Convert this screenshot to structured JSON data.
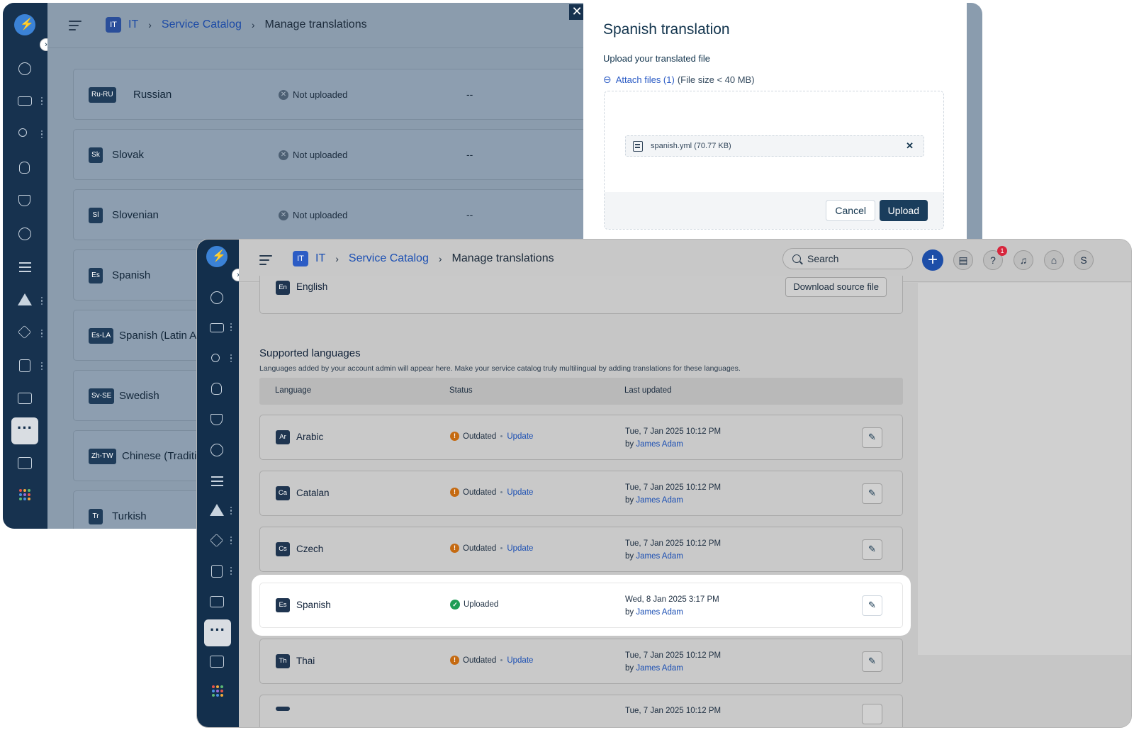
{
  "breadcrumb": {
    "workspace_badge": "IT",
    "workspace": "IT",
    "catalog": "Service Catalog",
    "current": "Manage translations"
  },
  "back": {
    "rows": [
      {
        "code": "Ru-RU",
        "name": "Russian",
        "status": "Not uploaded",
        "updated": "--"
      },
      {
        "code": "Sk",
        "name": "Slovak",
        "status": "Not uploaded",
        "updated": "--"
      },
      {
        "code": "Sl",
        "name": "Slovenian",
        "status": "Not uploaded",
        "updated": "--"
      },
      {
        "code": "Es",
        "name": "Spanish"
      },
      {
        "code": "Es-LA",
        "name": "Spanish (Latin Ar"
      },
      {
        "code": "Sv-SE",
        "name": "Swedish"
      },
      {
        "code": "Zh-TW",
        "name": "Chinese (Traditio"
      },
      {
        "code": "Tr",
        "name": "Turkish"
      }
    ]
  },
  "modal": {
    "title": "Spanish translation",
    "subtitle": "Upload your translated file",
    "attach_label": "Attach files (1)",
    "attach_note": "(File size < 40 MB)",
    "file_name": "spanish.yml (70.77 KB)",
    "cancel": "Cancel",
    "upload": "Upload"
  },
  "header": {
    "search_placeholder": "Search",
    "notification_count": "1",
    "avatar_initial": "S"
  },
  "source": {
    "code": "En",
    "name": "English",
    "download_label": "Download source file"
  },
  "supported": {
    "title": "Supported languages",
    "description": "Languages added by your account admin will appear here. Make your service catalog truly multilingual by adding translations for these languages.",
    "columns": [
      "Language",
      "Status",
      "Last updated"
    ],
    "rows": [
      {
        "code": "Ar",
        "name": "Arabic",
        "status": "Outdated",
        "action": "Update",
        "date": "Tue, 7 Jan 2025 10:12 PM",
        "by": "by",
        "author": "James Adam"
      },
      {
        "code": "Ca",
        "name": "Catalan",
        "status": "Outdated",
        "action": "Update",
        "date": "Tue, 7 Jan 2025 10:12 PM",
        "by": "by",
        "author": "James Adam"
      },
      {
        "code": "Cs",
        "name": "Czech",
        "status": "Outdated",
        "action": "Update",
        "date": "Tue, 7 Jan 2025 10:12 PM",
        "by": "by",
        "author": "James Adam"
      },
      {
        "code": "Es",
        "name": "Spanish",
        "status": "Uploaded",
        "action": "",
        "date": "Wed, 8 Jan 2025 3:17 PM",
        "by": "by",
        "author": "James Adam"
      },
      {
        "code": "Th",
        "name": "Thai",
        "status": "Outdated",
        "action": "Update",
        "date": "Tue, 7 Jan 2025 10:12 PM",
        "by": "by",
        "author": "James Adam"
      },
      {
        "code": "",
        "name": "",
        "status": "",
        "action": "",
        "date": "Tue, 7 Jan 2025 10:12 PM",
        "by": "",
        "author": ""
      }
    ]
  },
  "colors": {
    "sidebar": "#132f4c",
    "primary": "#1a3d5c",
    "link": "#2c5cc5",
    "outdated": "#c56a11",
    "uploaded": "#1f9d55"
  }
}
